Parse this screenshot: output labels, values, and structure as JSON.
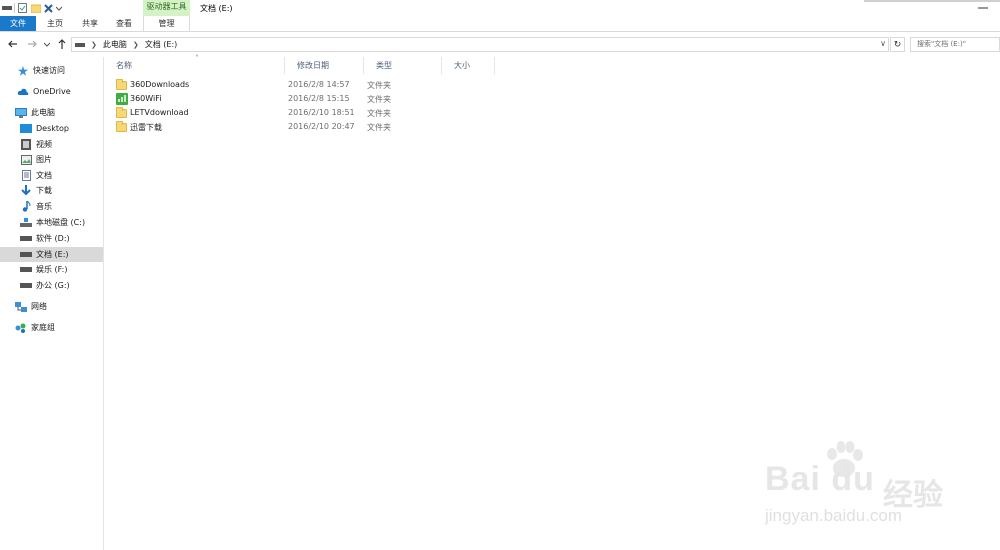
{
  "window": {
    "title": "文档 (E:)",
    "context_tab_header": "驱动器工具"
  },
  "ribbon": {
    "tabs": [
      "文件",
      "主页",
      "共享",
      "查看",
      "管理"
    ]
  },
  "address": {
    "crumbs": [
      "此电脑",
      "文档 (E:)"
    ],
    "search_placeholder": "搜索\"文档 (E:)\""
  },
  "navpane": {
    "items": [
      {
        "label": "快速访问",
        "icon": "star-icon"
      },
      {
        "label": "OneDrive",
        "icon": "cloud-icon"
      },
      {
        "label": "此电脑",
        "icon": "computer-icon"
      },
      {
        "label": "Desktop",
        "icon": "desktop-icon"
      },
      {
        "label": "视频",
        "icon": "video-icon"
      },
      {
        "label": "图片",
        "icon": "picture-icon"
      },
      {
        "label": "文档",
        "icon": "document-icon"
      },
      {
        "label": "下载",
        "icon": "download-icon"
      },
      {
        "label": "音乐",
        "icon": "music-icon"
      },
      {
        "label": "本地磁盘 (C:)",
        "icon": "system-drive-icon"
      },
      {
        "label": "软件 (D:)",
        "icon": "drive-icon"
      },
      {
        "label": "文档 (E:)",
        "icon": "drive-icon"
      },
      {
        "label": "娱乐 (F:)",
        "icon": "drive-icon"
      },
      {
        "label": "办公 (G:)",
        "icon": "drive-icon"
      },
      {
        "label": "网络",
        "icon": "network-icon"
      },
      {
        "label": "家庭组",
        "icon": "homegroup-icon"
      }
    ]
  },
  "columns": [
    "名称",
    "修改日期",
    "类型",
    "大小"
  ],
  "files": [
    {
      "name": "360Downloads",
      "date": "2016/2/8 14:57",
      "type": "文件夹",
      "icon": "folder-icon"
    },
    {
      "name": "360WiFi",
      "date": "2016/2/8 15:15",
      "type": "文件夹",
      "icon": "wifi-app-folder-icon"
    },
    {
      "name": "LETVdownload",
      "date": "2016/2/10 18:51",
      "type": "文件夹",
      "icon": "folder-icon"
    },
    {
      "name": "迅雷下载",
      "date": "2016/2/10 20:47",
      "type": "文件夹",
      "icon": "folder-icon"
    }
  ],
  "watermark": {
    "logo_text": "Bai du",
    "cn_text": "经验",
    "url": "jingyan.baidu.com"
  },
  "colors": {
    "file_tab_bg": "#1979ca",
    "context_tab_bg": "#d4f2c6",
    "selected_nav_bg": "#d9d9d9"
  }
}
